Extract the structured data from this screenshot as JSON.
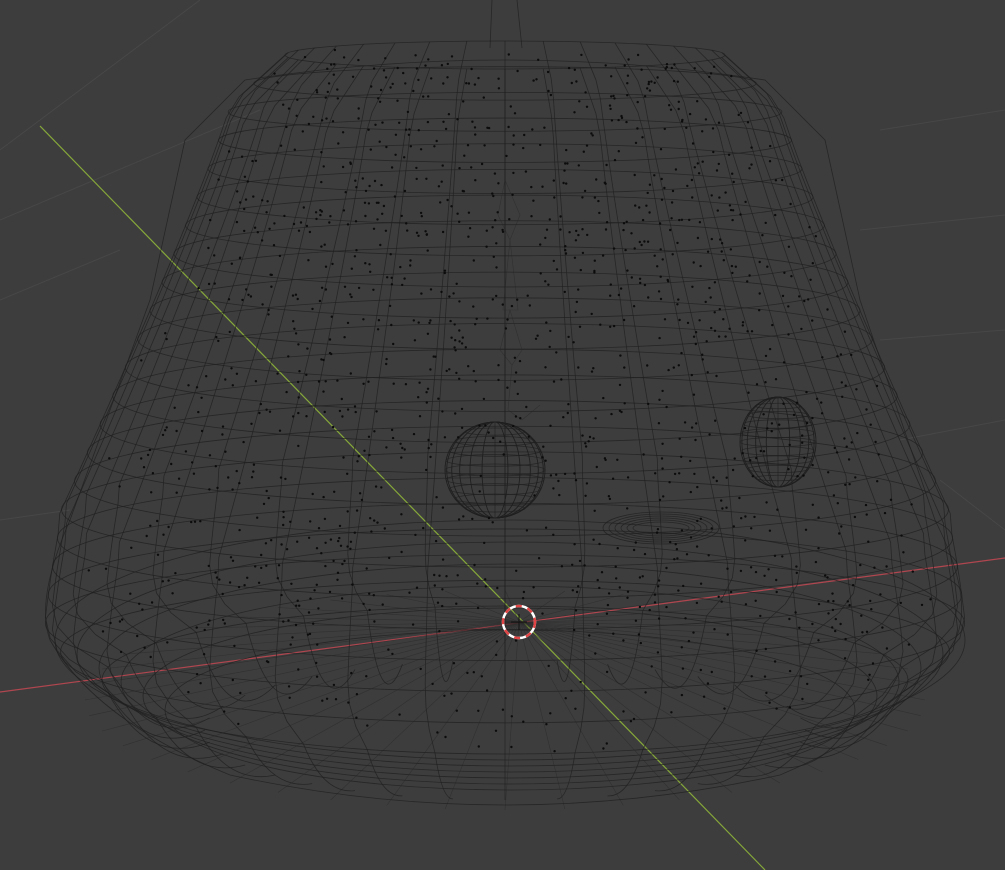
{
  "viewport": {
    "background": "#3d3d3d",
    "mode": "wireframe",
    "grid_color": "#474747",
    "wire_color": "#1f1f1f"
  },
  "axes": {
    "x_color": "#b0464f",
    "y_color": "#86a83a"
  },
  "objects": [
    {
      "name": "bell-mesh",
      "kind": "mesh"
    },
    {
      "name": "sphere-left",
      "kind": "mesh"
    },
    {
      "name": "sphere-right",
      "kind": "mesh"
    },
    {
      "name": "disc-flat",
      "kind": "mesh"
    },
    {
      "name": "hanging-rig",
      "kind": "mesh"
    }
  ],
  "cursor": {
    "icon": "3d-cursor-icon",
    "ring_color_a": "#e04444",
    "ring_color_b": "#ffffff"
  }
}
